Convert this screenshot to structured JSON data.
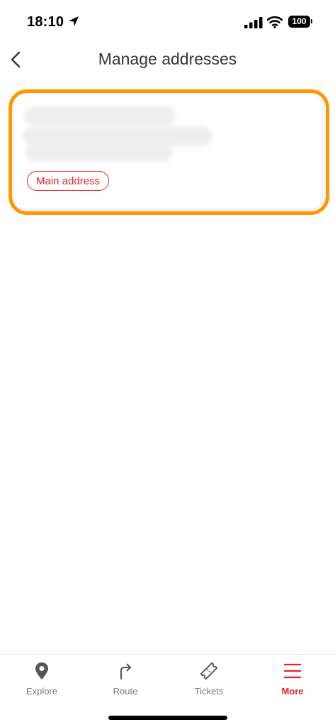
{
  "status_bar": {
    "time": "18:10",
    "battery": "100"
  },
  "header": {
    "title": "Manage addresses"
  },
  "address_card": {
    "badge": "Main address"
  },
  "tabs": [
    {
      "label": "Explore",
      "icon": "map-pin-icon",
      "active": false
    },
    {
      "label": "Route",
      "icon": "route-arrow-icon",
      "active": false
    },
    {
      "label": "Tickets",
      "icon": "ticket-icon",
      "active": false
    },
    {
      "label": "More",
      "icon": "menu-icon",
      "active": true
    }
  ],
  "colors": {
    "accent": "#e8242b",
    "highlight": "#ff9800"
  }
}
